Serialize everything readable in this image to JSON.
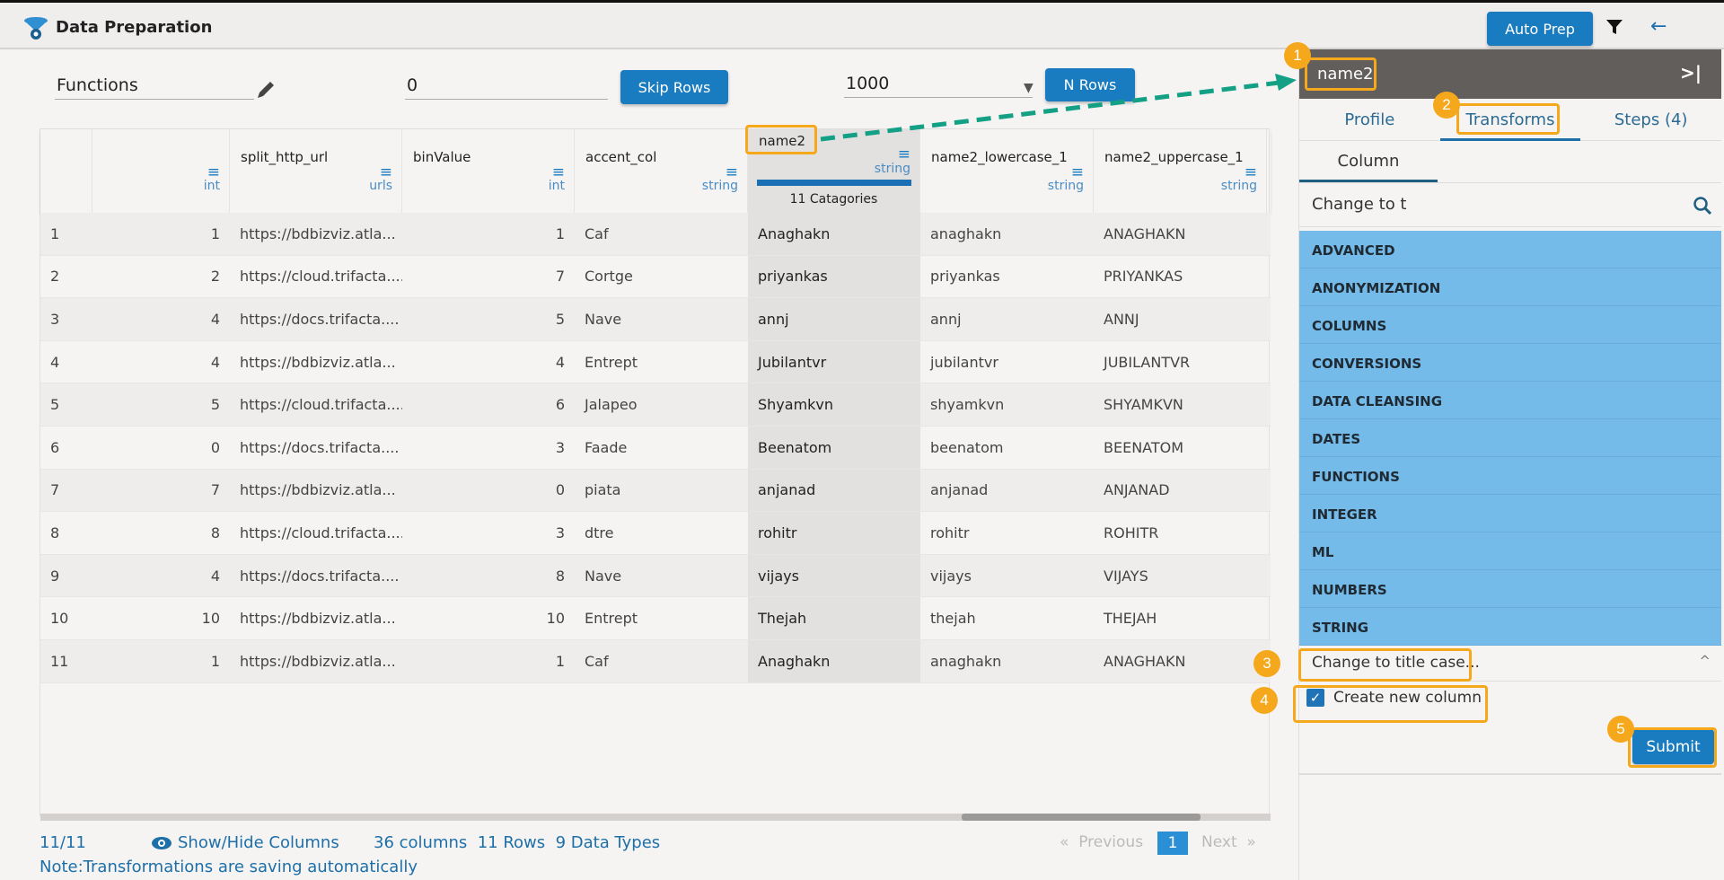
{
  "app": {
    "title": "Data Preparation",
    "auto_prep": "Auto Prep"
  },
  "toolbar": {
    "functions_value": "Functions",
    "skip_value": "0",
    "skip_button": "Skip Rows",
    "nrows_value": "1000",
    "nrows_button": "N Rows"
  },
  "table": {
    "columns": [
      {
        "name": "",
        "type": "int"
      },
      {
        "name": "split_http_url",
        "type": "urls"
      },
      {
        "name": "binValue",
        "type": "int"
      },
      {
        "name": "accent_col",
        "type": "string"
      },
      {
        "name": "name2",
        "type": "string",
        "categories": "11 Catagories"
      },
      {
        "name": "name2_lowercase_1",
        "type": "string"
      },
      {
        "name": "name2_uppercase_1",
        "type": "string"
      }
    ],
    "rows": [
      [
        "1",
        "1",
        "https://bdbizviz.atla...",
        "1",
        "Caf",
        "Anaghakn",
        "anaghakn",
        "ANAGHAKN"
      ],
      [
        "2",
        "2",
        "https://cloud.trifacta....",
        "7",
        "Cortge",
        "priyankas",
        "priyankas",
        "PRIYANKAS"
      ],
      [
        "3",
        "4",
        "https://docs.trifacta....",
        "5",
        "Nave",
        "annj",
        "annj",
        "ANNJ"
      ],
      [
        "4",
        "4",
        "https://bdbizviz.atla...",
        "4",
        "Entrept",
        "Jubilantvr",
        "jubilantvr",
        "JUBILANTVR"
      ],
      [
        "5",
        "5",
        "https://cloud.trifacta....",
        "6",
        "Jalapeo",
        "Shyamkvn",
        "shyamkvn",
        "SHYAMKVN"
      ],
      [
        "6",
        "0",
        "https://docs.trifacta....",
        "3",
        "Faade",
        "Beenatom",
        "beenatom",
        "BEENATOM"
      ],
      [
        "7",
        "7",
        "https://bdbizviz.atla...",
        "0",
        "piata",
        "anjanad",
        "anjanad",
        "ANJANAD"
      ],
      [
        "8",
        "8",
        "https://cloud.trifacta....",
        "3",
        "dtre",
        "rohitr",
        "rohitr",
        "ROHITR"
      ],
      [
        "9",
        "4",
        "https://docs.trifacta....",
        "8",
        "Nave",
        "vijays",
        "vijays",
        "VIJAYS"
      ],
      [
        "10",
        "10",
        "https://bdbizviz.atla...",
        "10",
        "Entrept",
        "Thejah",
        "thejah",
        "THEJAH"
      ],
      [
        "11",
        "1",
        "https://bdbizviz.atla...",
        "1",
        "Caf",
        "Anaghakn",
        "anaghakn",
        "ANAGHAKN"
      ]
    ]
  },
  "footer": {
    "count": "11/11",
    "show_hide": "Show/Hide Columns",
    "stats": "36 columns  11 Rows  9 Data Types",
    "prev": "«  Previous",
    "page": "1",
    "next": "Next  »",
    "note": "Note:Transformations are saving automatically"
  },
  "panel": {
    "column_name": "name2",
    "tabs": [
      "Profile",
      "Transforms",
      "Steps (4)"
    ],
    "subtab": "Column",
    "search_value": "Change to t",
    "categories": [
      "ADVANCED",
      "ANONYMIZATION",
      "COLUMNS",
      "CONVERSIONS",
      "DATA CLEANSING",
      "DATES",
      "FUNCTIONS",
      "INTEGER",
      "ML",
      "NUMBERS",
      "STRING"
    ],
    "selected_transform": "Change to title case...",
    "create_new_column": "Create new column",
    "create_new_column_checked": true,
    "submit": "Submit"
  },
  "annotations": [
    "1",
    "2",
    "3",
    "4",
    "5"
  ],
  "colors": {
    "accent": "#1a7cc0",
    "category_bg": "#74bbea",
    "highlight": "#f5a81c",
    "arrow": "#14a085"
  }
}
